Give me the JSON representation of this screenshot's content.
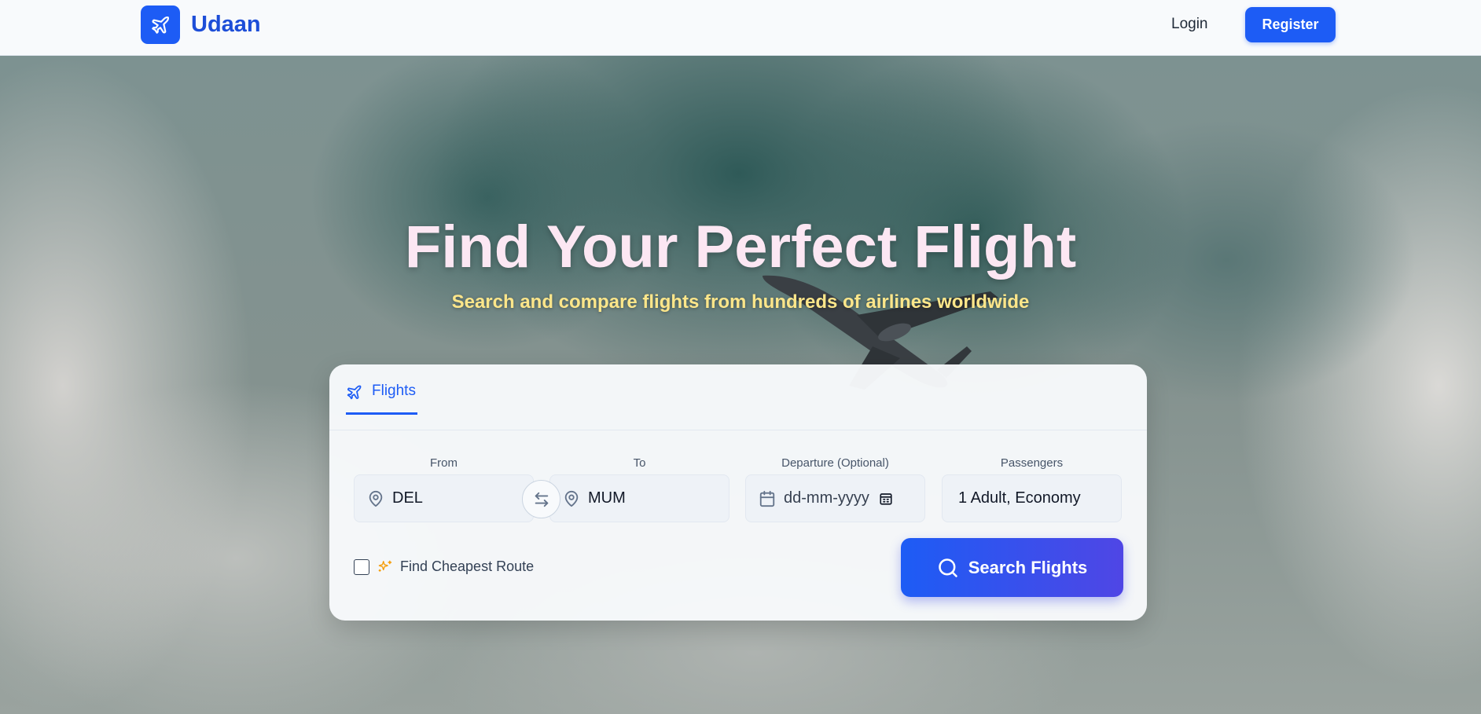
{
  "colors": {
    "accent": "#1d5cf5",
    "brand_text": "#1d4ed8",
    "title": "#fce7f3",
    "subtitle": "#fde68a",
    "search_gradient_end": "#4f46e5",
    "cheapest_icon": "#f59e0b"
  },
  "nav": {
    "brand_name": "Udaan",
    "brand_icon": "plane-icon",
    "login_label": "Login",
    "register_label": "Register"
  },
  "hero": {
    "title": "Find Your Perfect Flight",
    "subtitle": "Search and compare flights from hundreds of airlines worldwide"
  },
  "search": {
    "tab": {
      "label": "Flights",
      "icon": "plane-icon"
    },
    "from": {
      "label": "From",
      "value": "DEL",
      "icon": "map-pin-icon"
    },
    "swap_icon": "swap-arrows-icon",
    "to": {
      "label": "To",
      "value": "MUM",
      "icon": "map-pin-icon"
    },
    "departure": {
      "label": "Departure (Optional)",
      "placeholder": "dd-mm-yyyy",
      "icon": "calendar-icon",
      "picker_icon": "calendar-picker-icon"
    },
    "passengers": {
      "label": "Passengers",
      "value": "1 Adult, Economy"
    },
    "cheapest": {
      "label": "Find Cheapest Route",
      "checked": false,
      "icon": "sparkles-icon"
    },
    "button_label": "Search Flights",
    "button_icon": "search-icon"
  }
}
